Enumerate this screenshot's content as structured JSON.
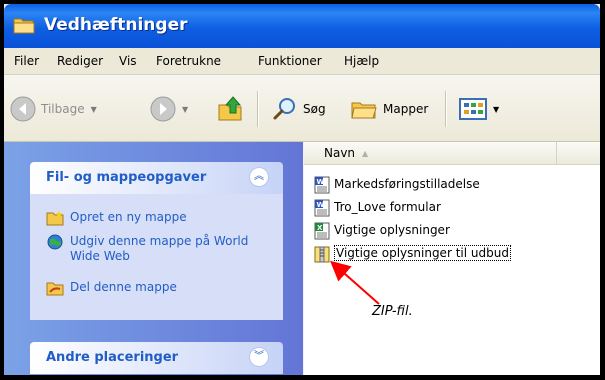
{
  "window": {
    "title": "Vedhæftninger"
  },
  "menu": [
    "Filer",
    "Rediger",
    "Vis",
    "Foretrukne",
    "Funktioner",
    "Hjælp"
  ],
  "toolbar": {
    "back_label": "Tilbage",
    "search_label": "Søg",
    "folders_label": "Mapper"
  },
  "taskpane": {
    "file_tasks": {
      "title": "Fil- og mappeopgaver",
      "items": [
        {
          "label": "Opret en ny mappe",
          "icon": "new-folder-icon"
        },
        {
          "label": "Udgiv denne mappe på World Wide Web",
          "icon": "publish-web-icon"
        },
        {
          "label": "Del denne mappe",
          "icon": "share-folder-icon"
        }
      ]
    },
    "other_places": {
      "title": "Andre placeringer"
    }
  },
  "filelist": {
    "column": "Navn",
    "files": [
      {
        "name": "Markedsføringstilladelse",
        "type": "word"
      },
      {
        "name": "Tro_Love formular",
        "type": "word"
      },
      {
        "name": "Vigtige oplysninger",
        "type": "excel"
      },
      {
        "name": "Vigtige oplysninger til udbud",
        "type": "zip",
        "selected": true
      }
    ]
  },
  "annotation": {
    "text": "ZIP-fil."
  },
  "colors": {
    "titlebar": "#0a5de3",
    "taskpane": "#7ba2e7",
    "task_link": "#215dc6",
    "arrow": "#ff0000"
  }
}
